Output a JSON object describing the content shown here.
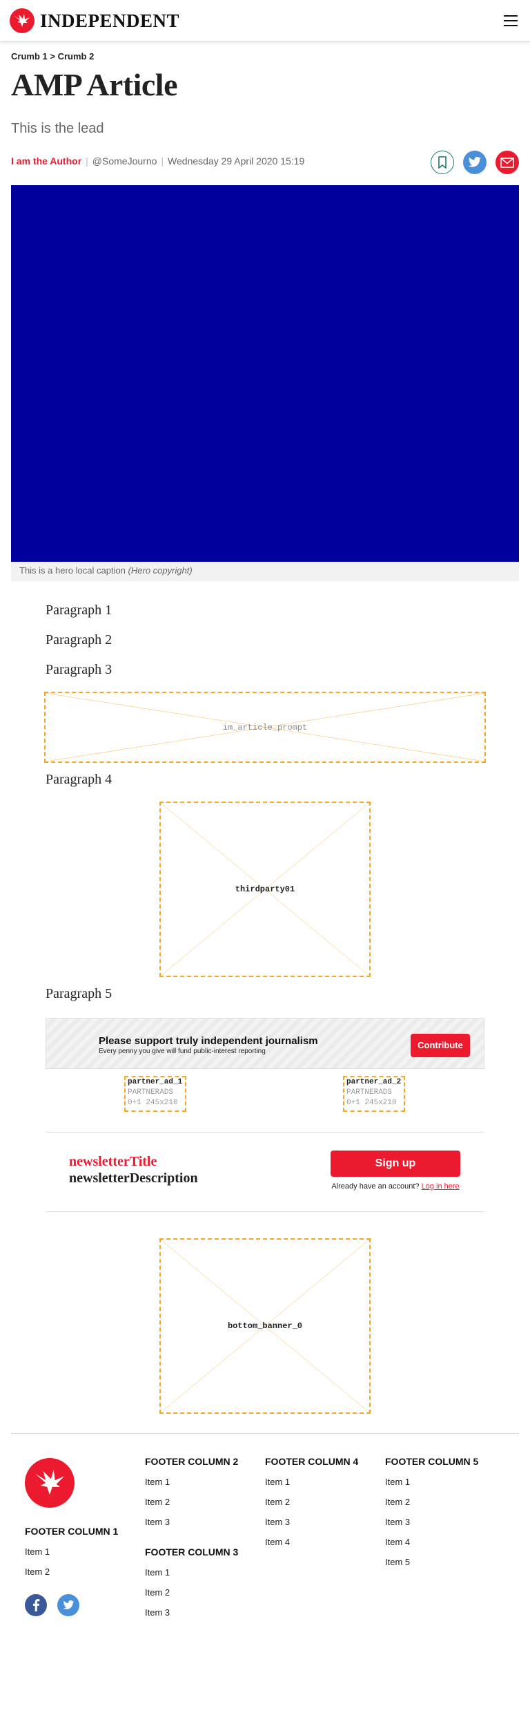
{
  "header": {
    "logo_text": "INDEPENDENT",
    "menu_icon": "hamburger-menu-icon"
  },
  "breadcrumb": {
    "crumb1": "Crumb 1",
    "separator": ">",
    "crumb2": "Crumb 2"
  },
  "article": {
    "title": "AMP Article",
    "lead": "This is the lead",
    "author": "I am the Author",
    "handle": "@SomeJourno",
    "date": "Wednesday 29 April 2020 15:19",
    "hero_caption": "This is a hero local caption",
    "hero_copyright": "(Hero copyright)",
    "paragraphs": [
      "Paragraph 1",
      "Paragraph 2",
      "Paragraph 3",
      "Paragraph 4",
      "Paragraph 5"
    ]
  },
  "share": {
    "icons": [
      "bookmark-icon",
      "twitter-icon",
      "email-icon"
    ]
  },
  "ads": {
    "in_article": "im_article_prompt",
    "thirdparty": "thirdparty01",
    "bottom_banner": "bottom_banner_0",
    "partner1": {
      "name": "partner_ad_1",
      "group": "PARTNERADS",
      "size": "0+1 245x210"
    },
    "partner2": {
      "name": "partner_ad_2",
      "group": "PARTNERADS",
      "size": "0+1 245x210"
    }
  },
  "support": {
    "title": "Please support truly independent journalism",
    "subtitle": "Every penny you give will fund public-interest reporting",
    "button": "Contribute"
  },
  "newsletter": {
    "title": "newsletterTitle",
    "description": "newsletterDescription",
    "signup": "Sign up",
    "have_account": "Already have an account?",
    "login": "Log in here"
  },
  "footer": {
    "col1": {
      "title": "FOOTER COLUMN 1",
      "items": [
        "Item 1",
        "Item 2"
      ]
    },
    "col2": {
      "title": "FOOTER COLUMN 2",
      "items": [
        "Item 1",
        "Item 2",
        "Item 3"
      ]
    },
    "col3": {
      "title": "FOOTER COLUMN 3",
      "items": [
        "Item 1",
        "Item 2",
        "Item 3"
      ]
    },
    "col4": {
      "title": "FOOTER COLUMN 4",
      "items": [
        "Item 1",
        "Item 2",
        "Item 3",
        "Item 4"
      ]
    },
    "col5": {
      "title": "FOOTER COLUMN 5",
      "items": [
        "Item 1",
        "Item 2",
        "Item 3",
        "Item 4",
        "Item 5"
      ]
    },
    "social_icons": [
      "facebook-icon",
      "twitter-icon"
    ]
  },
  "colors": {
    "brand_red": "#ec1a2e",
    "hero_blue": "#00009c",
    "placeholder_orange": "#f5a623",
    "twitter_blue": "#4a90d9",
    "facebook_blue": "#3b5998"
  }
}
